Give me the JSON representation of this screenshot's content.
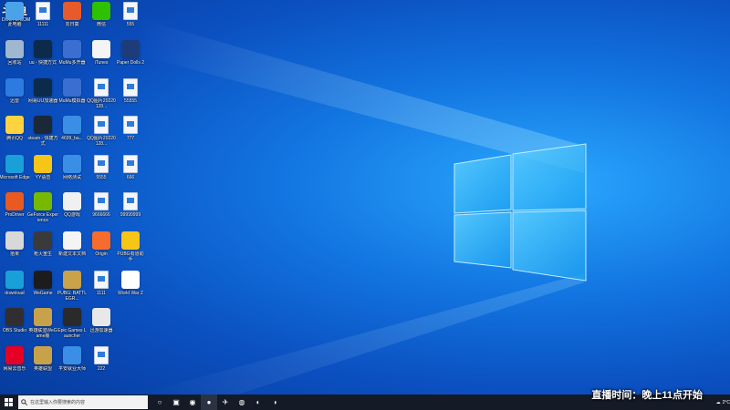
{
  "watermark": {
    "brand": "斗鱼",
    "url": "DOUYU.COM"
  },
  "desktop_icons": [
    {
      "label": "此电脑",
      "icon": "computer-icon",
      "color": "#4aa3e8"
    },
    {
      "label": "11111",
      "icon": "file-icon",
      "color": "#2f7bd8"
    },
    {
      "label": "向日葵",
      "icon": "sunlogin-icon",
      "color": "#e65a2b"
    },
    {
      "label": "微信",
      "icon": "wechat-icon",
      "color": "#2dc100"
    },
    {
      "label": "555",
      "icon": "file-icon",
      "color": "#2f7bd8"
    },
    {
      "label": "回收站",
      "icon": "recycle-bin-icon",
      "color": "#9fb7cf"
    },
    {
      "label": "uu - 快捷方式",
      "icon": "uu-accelerator-icon",
      "color": "#0c2a4a"
    },
    {
      "label": "MuMu多开器",
      "icon": "mumu-multi-icon",
      "color": "#3a6fd1"
    },
    {
      "label": "iTunes",
      "icon": "itunes-icon",
      "color": "#f4f4f4"
    },
    {
      "label": "Paper Dolls 2",
      "icon": "paper-dolls-icon",
      "color": "#1f3c7a"
    },
    {
      "label": "迅雷",
      "icon": "xunlei-icon",
      "color": "#2d7be0"
    },
    {
      "label": "网易UU加速器",
      "icon": "uu-accelerator-icon",
      "color": "#0c2a4a"
    },
    {
      "label": "MuMu模拟器",
      "icon": "mumu-emulator-icon",
      "color": "#3a6fd1"
    },
    {
      "label": "QQ图片20220128...",
      "icon": "image-file-icon",
      "color": "#2f7bd8"
    },
    {
      "label": "55555",
      "icon": "file-icon",
      "color": "#2f7bd8"
    },
    {
      "label": "腾讯QQ",
      "icon": "qq-icon",
      "color": "#ffd23f"
    },
    {
      "label": "steam - 快捷方式",
      "icon": "steam-icon",
      "color": "#1b2838"
    },
    {
      "label": "4699_ba...",
      "icon": "browser-icon",
      "color": "#3a8ee6"
    },
    {
      "label": "QQ图片20220128...",
      "icon": "image-file-icon",
      "color": "#2f7bd8"
    },
    {
      "label": "777",
      "icon": "file-icon",
      "color": "#2f7bd8"
    },
    {
      "label": "Microsoft Edge",
      "icon": "edge-icon",
      "color": "#1aa0d8"
    },
    {
      "label": "YY语音",
      "icon": "yy-icon",
      "color": "#f5c518"
    },
    {
      "label": "网络测试",
      "icon": "network-icon",
      "color": "#3a8ee6"
    },
    {
      "label": "5555",
      "icon": "file-icon",
      "color": "#2f7bd8"
    },
    {
      "label": "666",
      "icon": "file-icon",
      "color": "#2f7bd8"
    },
    {
      "label": "ProDriver",
      "icon": "prodriver-icon",
      "color": "#e85a20"
    },
    {
      "label": "GeForce Experience",
      "icon": "geforce-icon",
      "color": "#76b900"
    },
    {
      "label": "QQ游戏",
      "icon": "qq-game-icon",
      "color": "#f0f0f0"
    },
    {
      "label": "9666666",
      "icon": "file-icon",
      "color": "#2f7bd8"
    },
    {
      "label": "99999999",
      "icon": "file-icon",
      "color": "#2f7bd8"
    },
    {
      "label": "拾果",
      "icon": "app-icon",
      "color": "#d8d8d8"
    },
    {
      "label": "枪火重生",
      "icon": "game-icon",
      "color": "#3a3a3a"
    },
    {
      "label": "新建文本文档",
      "icon": "text-file-icon",
      "color": "#f4f4f4"
    },
    {
      "label": "Origin",
      "icon": "origin-icon",
      "color": "#f56c2d"
    },
    {
      "label": "PUBG有道助手",
      "icon": "game-icon",
      "color": "#f5c518"
    },
    {
      "label": "download",
      "icon": "edge-icon",
      "color": "#1aa0d8"
    },
    {
      "label": "WeGame",
      "icon": "wegame-icon",
      "color": "#1c1c1c"
    },
    {
      "label": "PUBG: BATTLEGR...",
      "icon": "pubg-icon",
      "color": "#c9a24a"
    },
    {
      "label": "1111",
      "icon": "file-icon",
      "color": "#2f7bd8"
    },
    {
      "label": "World War Z",
      "icon": "wwz-icon",
      "color": "#ffffff"
    },
    {
      "label": "OBS Studio",
      "icon": "obs-icon",
      "color": "#302e31"
    },
    {
      "label": "英雄联盟WeGame版",
      "icon": "lol-icon",
      "color": "#c8a24a"
    },
    {
      "label": "Epic Games Launcher",
      "icon": "epic-icon",
      "color": "#2a2a2a"
    },
    {
      "label": "迅游加速器",
      "icon": "xunyou-icon",
      "color": "#e8e8e8"
    },
    {
      "label": "网易云音乐",
      "icon": "netease-music-icon",
      "color": "#e60026"
    },
    {
      "label": "英雄联盟",
      "icon": "lol-icon",
      "color": "#c8a24a"
    },
    {
      "label": "平安就业大师",
      "icon": "app-icon",
      "color": "#3a8ee6"
    },
    {
      "label": "222",
      "icon": "file-icon",
      "color": "#2f7bd8"
    }
  ],
  "taskbar": {
    "search_placeholder": "在这里输入你要搜索的内容",
    "apps": [
      {
        "name": "task-view",
        "icon": "task-view-icon",
        "glyph": "○"
      },
      {
        "name": "multitask",
        "icon": "multitask-icon",
        "glyph": "▣"
      },
      {
        "name": "edge",
        "icon": "edge-icon",
        "glyph": "◉"
      },
      {
        "name": "obs",
        "icon": "obs-icon",
        "glyph": "●"
      },
      {
        "name": "xunlei",
        "icon": "xunlei-icon",
        "glyph": "✈"
      },
      {
        "name": "netease-music",
        "icon": "netease-music-icon",
        "glyph": "◍"
      },
      {
        "name": "steam",
        "icon": "steam-icon",
        "glyph": "◐"
      },
      {
        "name": "steam-alt",
        "icon": "steam-alt-icon",
        "glyph": "◑"
      }
    ]
  },
  "overlay": {
    "text": "直播时间：晚上11点开始"
  },
  "tray": {
    "temp": "2°C"
  }
}
